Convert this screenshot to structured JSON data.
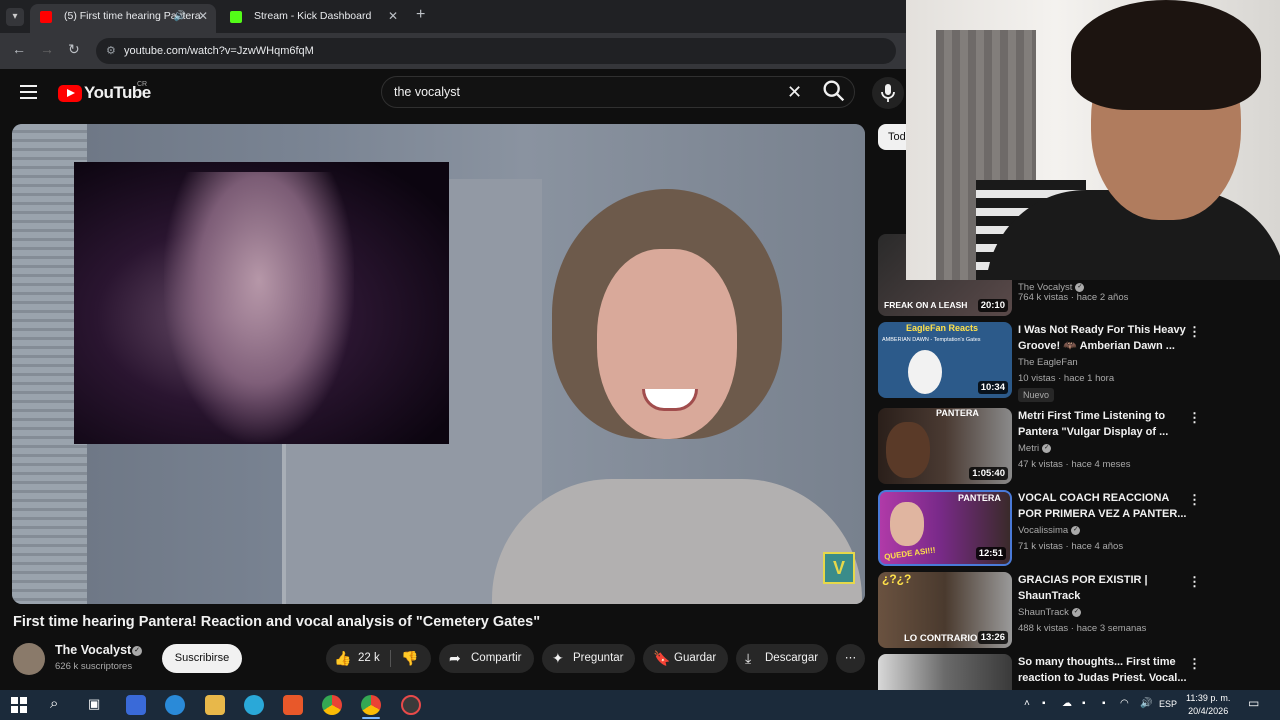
{
  "browser": {
    "tabs": [
      {
        "title": "(5) First time hearing Pantera",
        "active": true,
        "favicon_color": "#ff0000"
      },
      {
        "title": "Stream - Kick Dashboard",
        "active": false,
        "favicon_color": "#53fc18"
      }
    ],
    "url": "youtube.com/watch?v=JzwWHqm6fqM"
  },
  "youtube": {
    "logo_text": "YouTube",
    "region": "CR",
    "search_query": "the vocalyst"
  },
  "video": {
    "title": "First time hearing Pantera! Reaction and vocal analysis of \"Cemetery Gates\"",
    "channel": "The Vocalyst",
    "subscribers": "626 k suscriptores",
    "subscribe_label": "Suscribirse",
    "likes": "22 k",
    "share_label": "Compartir",
    "ask_label": "Preguntar",
    "save_label": "Guardar",
    "download_label": "Descargar",
    "watermark": "V"
  },
  "sidebar": {
    "chip": "Todos",
    "partial_item": {
      "thumb_text": "FREAK ON A LEASH",
      "duration": "20:10",
      "channel": "The Vocalyst",
      "meta": "764 k vistas · hace 2 años"
    },
    "items": [
      {
        "title": "I Was Not Ready For This Heavy Groove! 🦇 Amberian Dawn ...",
        "channel": "The EagleFan",
        "verified": false,
        "meta": "10 vistas · hace 1 hora",
        "duration": "10:34",
        "badge": "Nuevo",
        "thumb_text": "EagleFan Reacts",
        "thumb_sub": "AMBERIAN DAWN - Temptation's Gates",
        "thumb_color": "#2c5a8a"
      },
      {
        "title": "Metri First Time Listening to Pantera \"Vulgar Display of ...",
        "channel": "Metri",
        "verified": true,
        "meta": "47 k vistas · hace 4 meses",
        "duration": "1:05:40",
        "thumb_text": "PANTERA",
        "thumb_color": "#3a2f2a"
      },
      {
        "title": "VOCAL COACH REACCIONA POR PRIMERA VEZ A PANTER...",
        "channel": "Vocalissima",
        "verified": true,
        "meta": "71 k vistas · hace 4 años",
        "duration": "12:51",
        "thumb_text": "QUEDE ASI!!!",
        "thumb_color": "#7a2a8a"
      },
      {
        "title": "GRACIAS POR EXISTIR | ShaunTrack",
        "channel": "ShaunTrack",
        "verified": true,
        "meta": "488 k vistas · hace 3 semanas",
        "duration": "13:26",
        "thumb_text": "LO CONTRARIO",
        "thumb_top": "¿?¿?",
        "thumb_color": "#5a4a3a"
      },
      {
        "title": "So many thoughts... First time reaction to Judas Priest. Vocal...",
        "channel": "",
        "verified": false,
        "meta": "",
        "duration": "",
        "thumb_text": "",
        "thumb_color": "#8a8a8a"
      }
    ]
  },
  "taskbar": {
    "language": "ESP",
    "time": "11:39 p. m.",
    "date": "20/4/2026"
  }
}
